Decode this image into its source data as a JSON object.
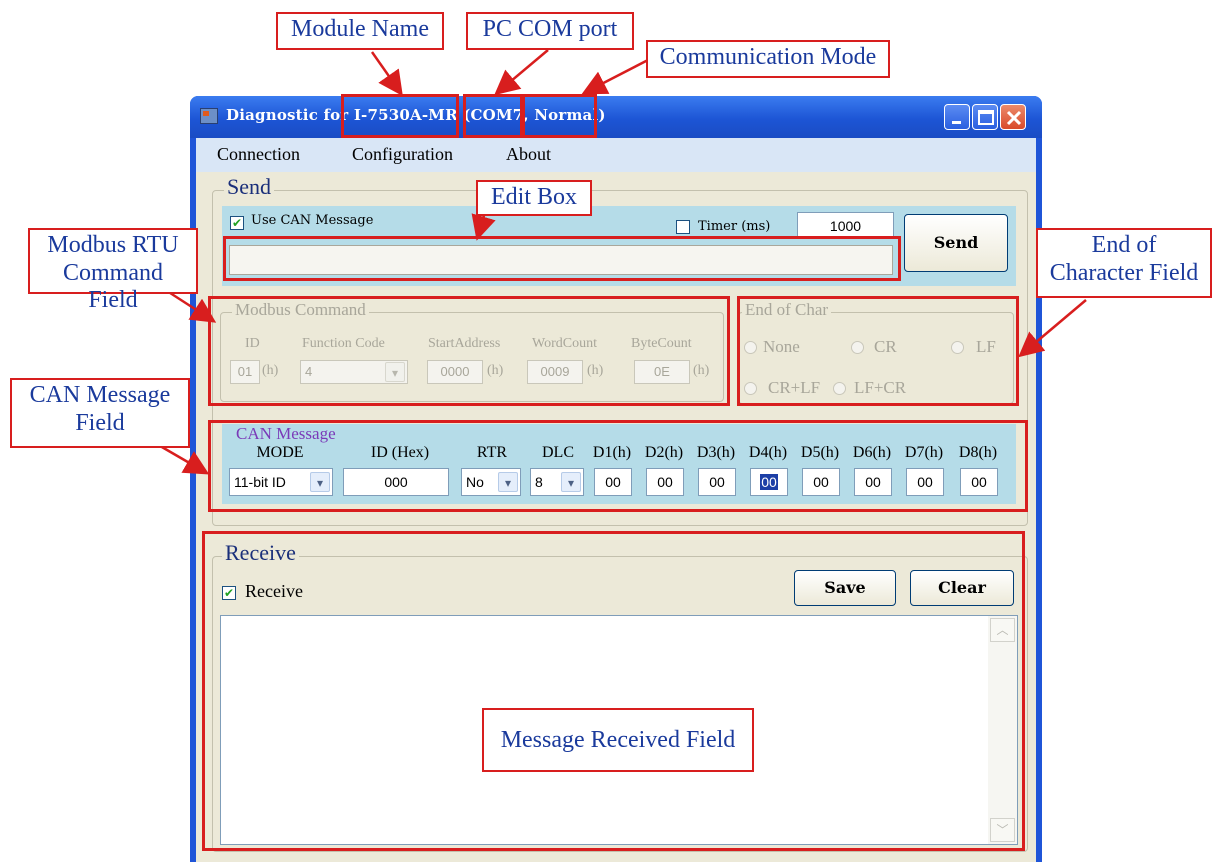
{
  "callouts": {
    "module_name": "Module Name",
    "pc_com_port": "PC COM port",
    "communication_mode": "Communication Mode",
    "edit_box": "Edit Box",
    "modbus_rtu_line1": "Modbus RTU",
    "modbus_rtu_line2": "Command Field",
    "end_of_char_line1": "End of",
    "end_of_char_line2": "Character Field",
    "can_message_line1": "CAN Message",
    "can_message_line2": "Field",
    "message_received": "Message Received Field"
  },
  "window": {
    "title_prefix": "Diagnostic for ",
    "module": "I-7530A-MR",
    "com": "(COM7,",
    "mode": "Normal)"
  },
  "menu": [
    "Connection",
    "Configuration",
    "About"
  ],
  "send": {
    "group_title": "Send",
    "use_can_label": "Use CAN Message",
    "use_can_checked": true,
    "timer_label": "Timer (ms)",
    "timer_checked": false,
    "timer_value": "1000",
    "send_button": "Send",
    "edit_value": ""
  },
  "modbus": {
    "title": "Modbus Command",
    "headers": [
      "ID",
      "Function Code",
      "StartAddress",
      "WordCount",
      "ByteCount"
    ],
    "id": "01",
    "function_code": "4",
    "start_address": "0000",
    "word_count": "0009",
    "byte_count": "0E",
    "hex_suffix": "(h)"
  },
  "end_of_char": {
    "title": "End of Char",
    "options": [
      "None",
      "CR",
      "LF",
      "CR+LF",
      "LF+CR"
    ]
  },
  "can": {
    "title": "CAN Message",
    "headers": [
      "MODE",
      "ID (Hex)",
      "RTR",
      "DLC",
      "D1(h)",
      "D2(h)",
      "D3(h)",
      "D4(h)",
      "D5(h)",
      "D6(h)",
      "D7(h)",
      "D8(h)"
    ],
    "mode": "11-bit ID",
    "id": "000",
    "rtr": "No",
    "dlc": "8",
    "data": [
      "00",
      "00",
      "00",
      "00",
      "00",
      "00",
      "00",
      "00"
    ]
  },
  "receive": {
    "group_title": "Receive",
    "receive_label": "Receive",
    "receive_checked": true,
    "save_button": "Save",
    "clear_button": "Clear"
  },
  "colors": {
    "annotation": "#d81e1e",
    "annotation_text": "#1a3a9c",
    "panel_blue": "#b5dce8",
    "titlebar": "#1d55d5"
  },
  "icons": {
    "min": "minimize-icon",
    "max": "maximize-icon",
    "close": "close-icon",
    "dropdown": "chevron-down-icon"
  }
}
